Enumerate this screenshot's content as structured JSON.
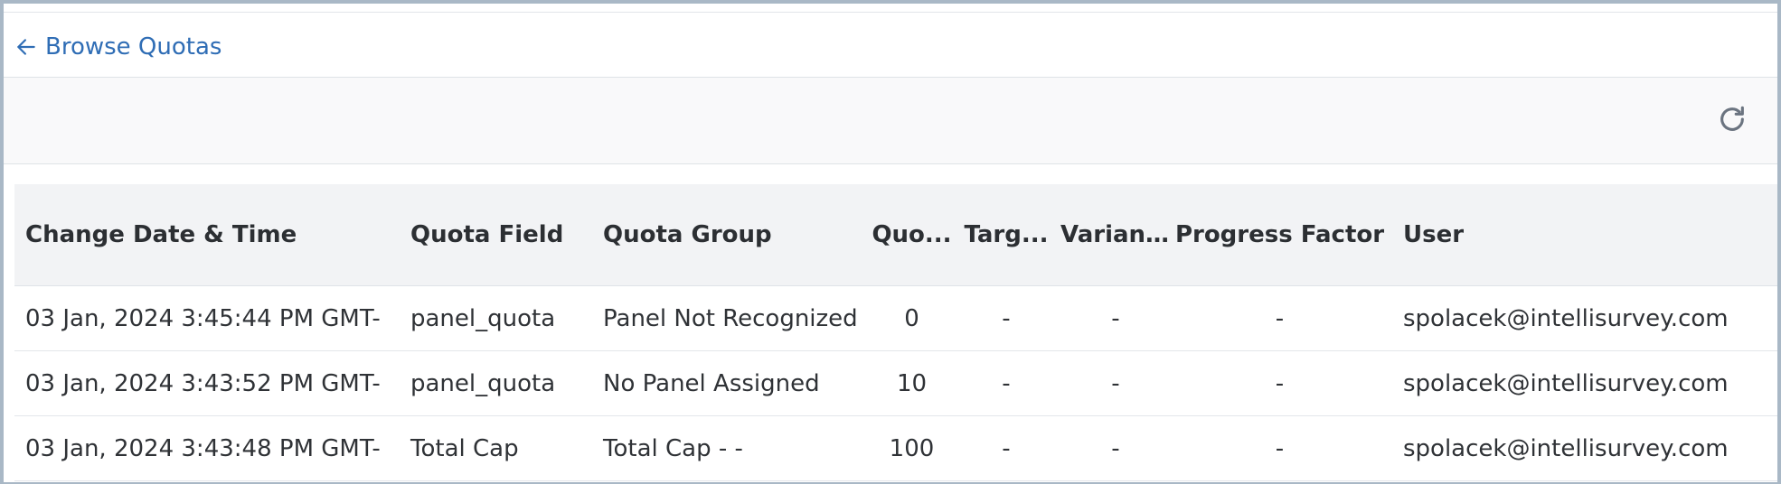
{
  "nav": {
    "back_label": "Browse Quotas"
  },
  "table": {
    "headers": {
      "change_date": "Change Date & Time",
      "quota_field": "Quota Field",
      "quota_group": "Quota Group",
      "quota": "Quo...",
      "target": "Targ...",
      "variance": "Varian...",
      "progress_factor": "Progress Factor",
      "user": "User"
    },
    "rows": [
      {
        "change_date": "03 Jan, 2024 3:45:44 PM GMT-",
        "quota_field": "panel_quota",
        "quota_group": "Panel Not Recognized",
        "quota": "0",
        "target": "-",
        "variance": "-",
        "progress_factor": "-",
        "user": "spolacek@intellisurvey.com"
      },
      {
        "change_date": "03 Jan, 2024 3:43:52 PM GMT-",
        "quota_field": "panel_quota",
        "quota_group": "No Panel Assigned",
        "quota": "10",
        "target": "-",
        "variance": "-",
        "progress_factor": "-",
        "user": "spolacek@intellisurvey.com"
      },
      {
        "change_date": "03 Jan, 2024 3:43:48 PM GMT-",
        "quota_field": "Total Cap",
        "quota_group": "Total Cap - -",
        "quota": "100",
        "target": "-",
        "variance": "-",
        "progress_factor": "-",
        "user": "spolacek@intellisurvey.com"
      }
    ]
  },
  "icons": {
    "back": "arrow-left-icon",
    "refresh": "refresh-icon"
  },
  "colors": {
    "link": "#2f6db5",
    "header_bg": "#f2f3f5",
    "toolbar_bg": "#f9f9fa",
    "icon_gray": "#6b7480"
  }
}
